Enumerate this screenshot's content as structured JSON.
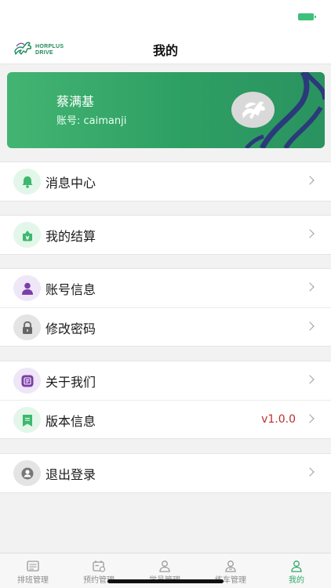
{
  "status_bar": {
    "battery_color": "#3fc07a"
  },
  "header": {
    "logo_text_line1": "HORPLUS",
    "logo_text_line2": "DRIVE",
    "logo_icon": "pegasus-icon",
    "title": "我的"
  },
  "profile": {
    "name": "蔡满基",
    "account": "账号: caimanji",
    "avatar_icon": "pegasus-icon",
    "card_color": "#34a869"
  },
  "menu_groups": [
    {
      "items": [
        {
          "label": "消息中心",
          "icon": "bell-icon"
        }
      ]
    },
    {
      "items": [
        {
          "label": "我的结算",
          "icon": "settlement-icon"
        }
      ]
    },
    {
      "items": [
        {
          "label": "账号信息",
          "icon": "user-icon"
        },
        {
          "label": "修改密码",
          "icon": "lock-icon"
        }
      ]
    },
    {
      "items": [
        {
          "label": "关于我们",
          "icon": "info-icon"
        },
        {
          "label": "版本信息",
          "icon": "bookmark-icon",
          "value": "v1.0.0"
        }
      ]
    },
    {
      "items": [
        {
          "label": "退出登录",
          "icon": "logout-icon"
        }
      ]
    }
  ],
  "tabs": [
    {
      "label": "排班管理",
      "icon": "schedule-icon",
      "active": false
    },
    {
      "label": "预约管理",
      "icon": "calendar-icon",
      "active": false
    },
    {
      "label": "学员管理",
      "icon": "student-icon",
      "active": false
    },
    {
      "label": "练车管理",
      "icon": "coach-icon",
      "active": false
    },
    {
      "label": "我的",
      "icon": "profile-icon",
      "active": true
    }
  ],
  "colors": {
    "accent": "#2fa96a",
    "version_text": "#b8312f"
  }
}
